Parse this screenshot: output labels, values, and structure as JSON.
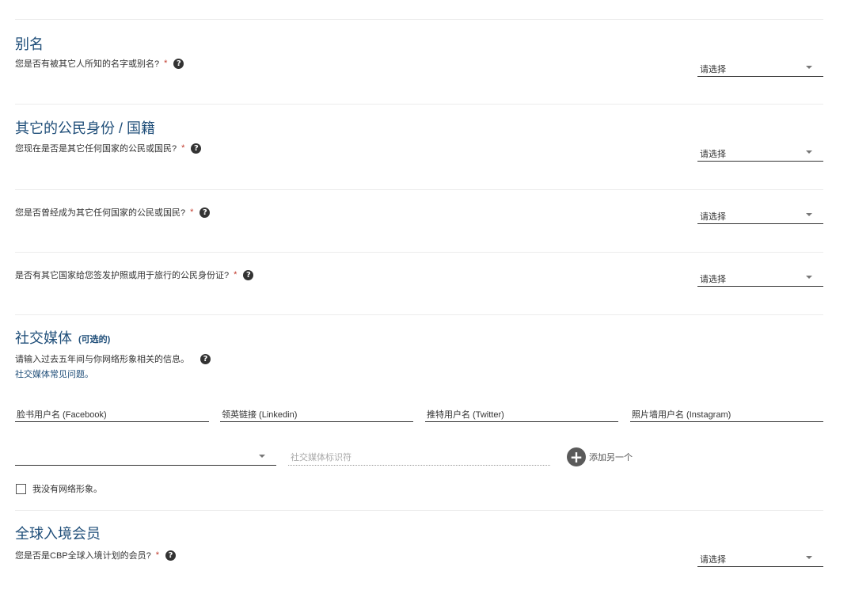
{
  "select_placeholder": "请选择",
  "aliases": {
    "title": "别名",
    "question": "您是否有被其它人所知的名字或别名?",
    "required_mark": "*"
  },
  "citizenship": {
    "title": "其它的公民身份 / 国籍",
    "q1": "您现在是否是其它任何国家的公民或国民?",
    "q2": "您是否曾经成为其它任何国家的公民或国民?",
    "q3": "是否有其它国家给您签发护照或用于旅行的公民身份证?",
    "required_mark": "*"
  },
  "social_media": {
    "title": "社交媒体",
    "optional": "(可选的)",
    "description": "请输入过去五年间与你网络形象相关的信息。",
    "faq_link": "社交媒体常见问题。",
    "fields": [
      "脸书用户名 (Facebook)",
      "领英链接 (Linkedin)",
      "推特用户名 (Twitter)",
      "照片墙用户名 (Instagram)"
    ],
    "identifier_placeholder": "社交媒体标识符",
    "add_another": "添加另一个",
    "no_presence": "我没有网络形象。"
  },
  "global_entry": {
    "title": "全球入境会员",
    "question": "您是否是CBP全球入境计划的会员?",
    "required_mark": "*"
  },
  "colors": {
    "heading": "#1f4e79",
    "required": "#c0392b"
  }
}
